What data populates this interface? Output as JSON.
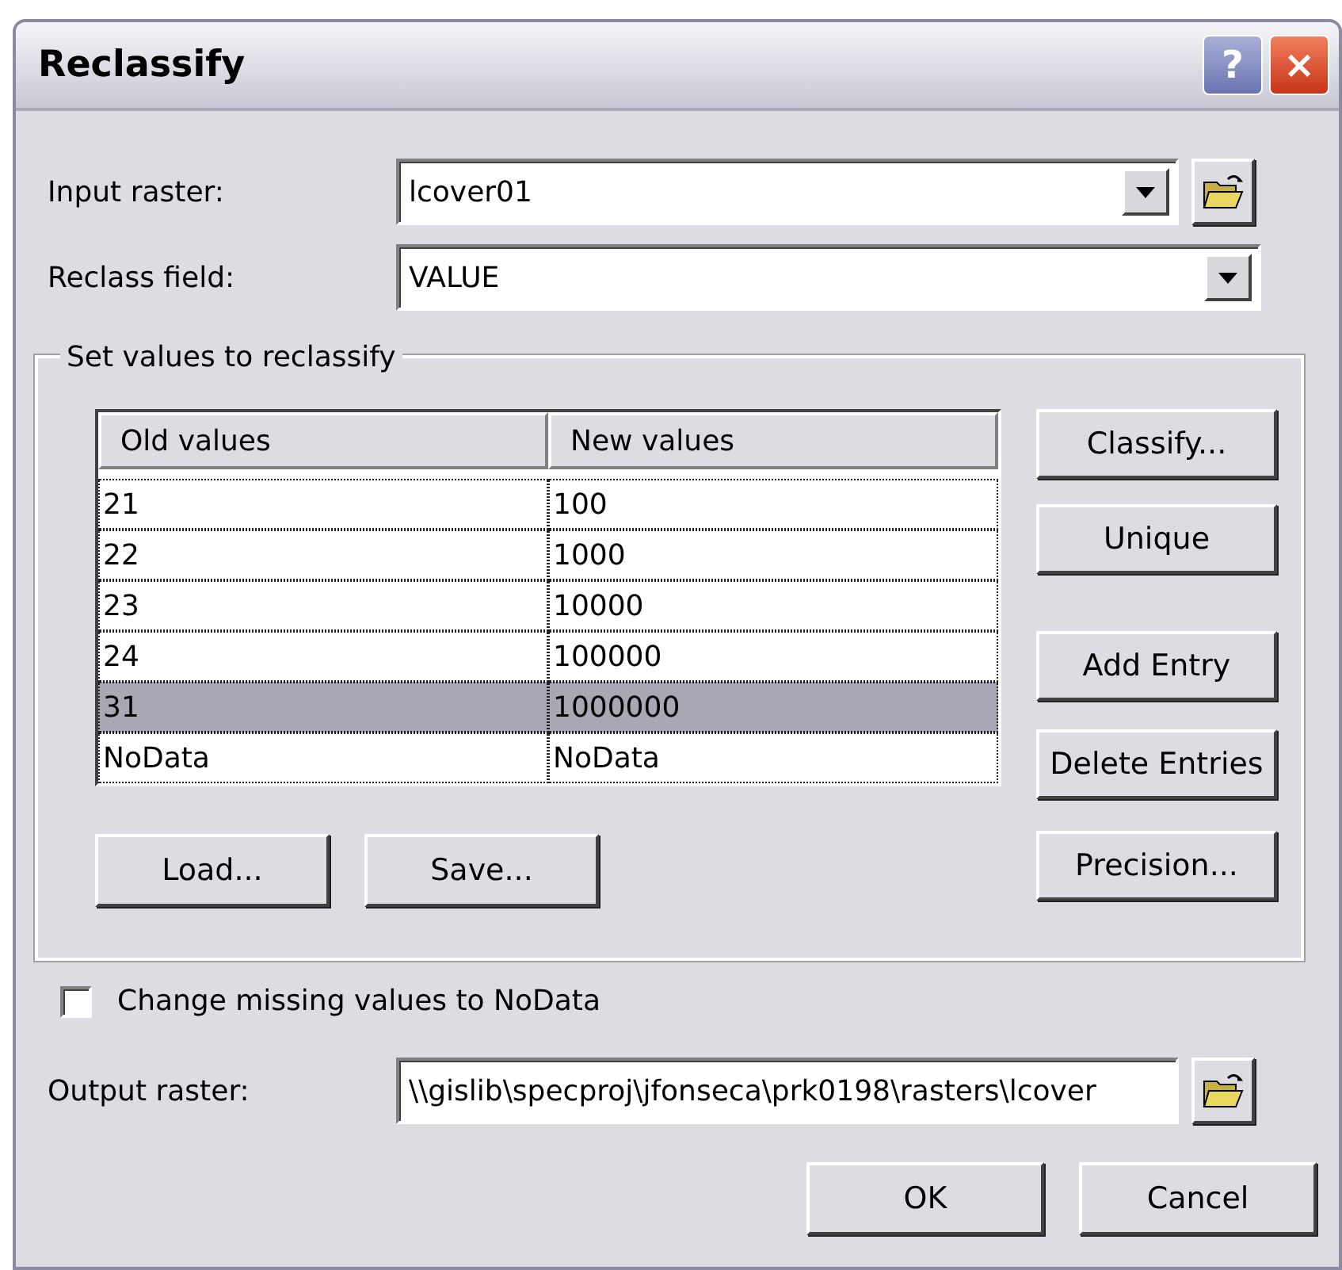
{
  "window": {
    "title": "Reclassify",
    "help_button": "?",
    "close_button": "×"
  },
  "input_raster": {
    "label": "Input raster:",
    "value": "lcover01"
  },
  "reclass_field": {
    "label": "Reclass field:",
    "value": "VALUE"
  },
  "group": {
    "title": "Set values to reclassify",
    "table": {
      "columns": [
        "Old values",
        "New values"
      ],
      "rows": [
        {
          "cells": [
            "21",
            "100"
          ],
          "selected": false
        },
        {
          "cells": [
            "22",
            "1000"
          ],
          "selected": false
        },
        {
          "cells": [
            "23",
            "10000"
          ],
          "selected": false
        },
        {
          "cells": [
            "24",
            "100000"
          ],
          "selected": false
        },
        {
          "cells": [
            "31",
            "1000000"
          ],
          "selected": true
        },
        {
          "cells": [
            "NoData",
            "NoData"
          ],
          "selected": false
        }
      ]
    },
    "side_buttons": [
      "Classify...",
      "Unique",
      "Add Entry",
      "Delete Entries",
      "Precision..."
    ],
    "bottom_buttons": [
      "Load...",
      "Save..."
    ]
  },
  "missing_to_nodata": {
    "label": "Change missing values to NoData",
    "checked": false
  },
  "output_raster": {
    "label": "Output raster:",
    "value": "\\\\gislib\\specproj\\jfonseca\\prk0198\\rasters\\lcover"
  },
  "buttons": [
    "OK",
    "Cancel"
  ]
}
